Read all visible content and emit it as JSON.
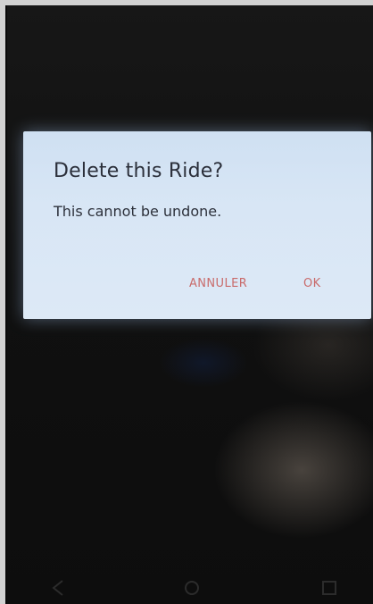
{
  "dialog": {
    "title": "Delete this Ride?",
    "message": "This cannot be undone.",
    "cancel_label": "ANNULER",
    "ok_label": "OK"
  },
  "colors": {
    "dialog_bg": "#d8e6f5",
    "button_text": "#c96b6b",
    "title_text": "#2b2f3a",
    "screen_bg": "#101010"
  },
  "nav_bar": {
    "icons": [
      "back-icon",
      "home-icon",
      "recent-apps-icon"
    ]
  }
}
